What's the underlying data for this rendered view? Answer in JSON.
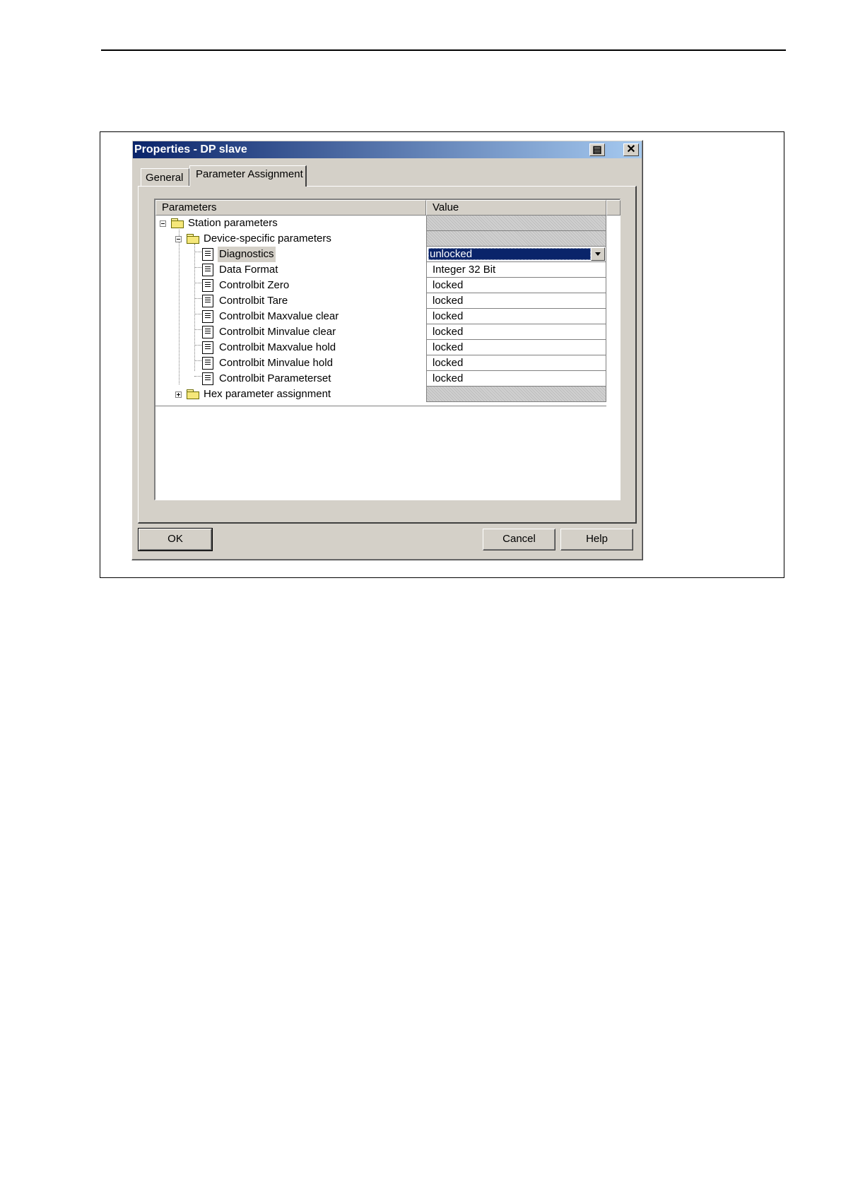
{
  "dialog": {
    "title": "Properties - DP slave",
    "tabs": [
      "General",
      "Parameter Assignment"
    ],
    "active_tab": "Parameter Assignment"
  },
  "grid": {
    "columns": [
      "Parameters",
      "Value"
    ],
    "rows": [
      {
        "label": "Station parameters",
        "value": "",
        "level": 0,
        "type": "folder",
        "expander": "minus"
      },
      {
        "label": "Device-specific parameters",
        "value": "",
        "level": 1,
        "type": "folder",
        "expander": "minus"
      },
      {
        "label": "Diagnostics",
        "value": "unlocked",
        "level": 2,
        "type": "param",
        "selected": true,
        "editor": "dropdown"
      },
      {
        "label": "Data Format",
        "value": "Integer 32 Bit",
        "level": 2,
        "type": "param"
      },
      {
        "label": "Controlbit Zero",
        "value": "locked",
        "level": 2,
        "type": "param"
      },
      {
        "label": "Controlbit Tare",
        "value": "locked",
        "level": 2,
        "type": "param"
      },
      {
        "label": "Controlbit Maxvalue clear",
        "value": "locked",
        "level": 2,
        "type": "param"
      },
      {
        "label": "Controlbit Minvalue clear",
        "value": "locked",
        "level": 2,
        "type": "param"
      },
      {
        "label": "Controlbit Maxvalue hold",
        "value": "locked",
        "level": 2,
        "type": "param"
      },
      {
        "label": "Controlbit Minvalue hold",
        "value": "locked",
        "level": 2,
        "type": "param"
      },
      {
        "label": "Controlbit Parameterset",
        "value": "locked",
        "level": 2,
        "type": "param"
      },
      {
        "label": "Hex parameter assignment",
        "value": "",
        "level": 1,
        "type": "folder",
        "expander": "plus"
      }
    ]
  },
  "buttons": {
    "ok": "OK",
    "cancel": "Cancel",
    "help": "Help"
  },
  "icons": {
    "titlebar_help": "help-icon",
    "titlebar_close": "close-icon",
    "folder": "folder-icon",
    "parameter": "document-icon",
    "dropdown": "chevron-down-icon"
  },
  "colors": {
    "titlebar_start": "#0a246a",
    "titlebar_end": "#a6caf0",
    "face": "#d4d0c8",
    "selection": "#0a246a"
  }
}
